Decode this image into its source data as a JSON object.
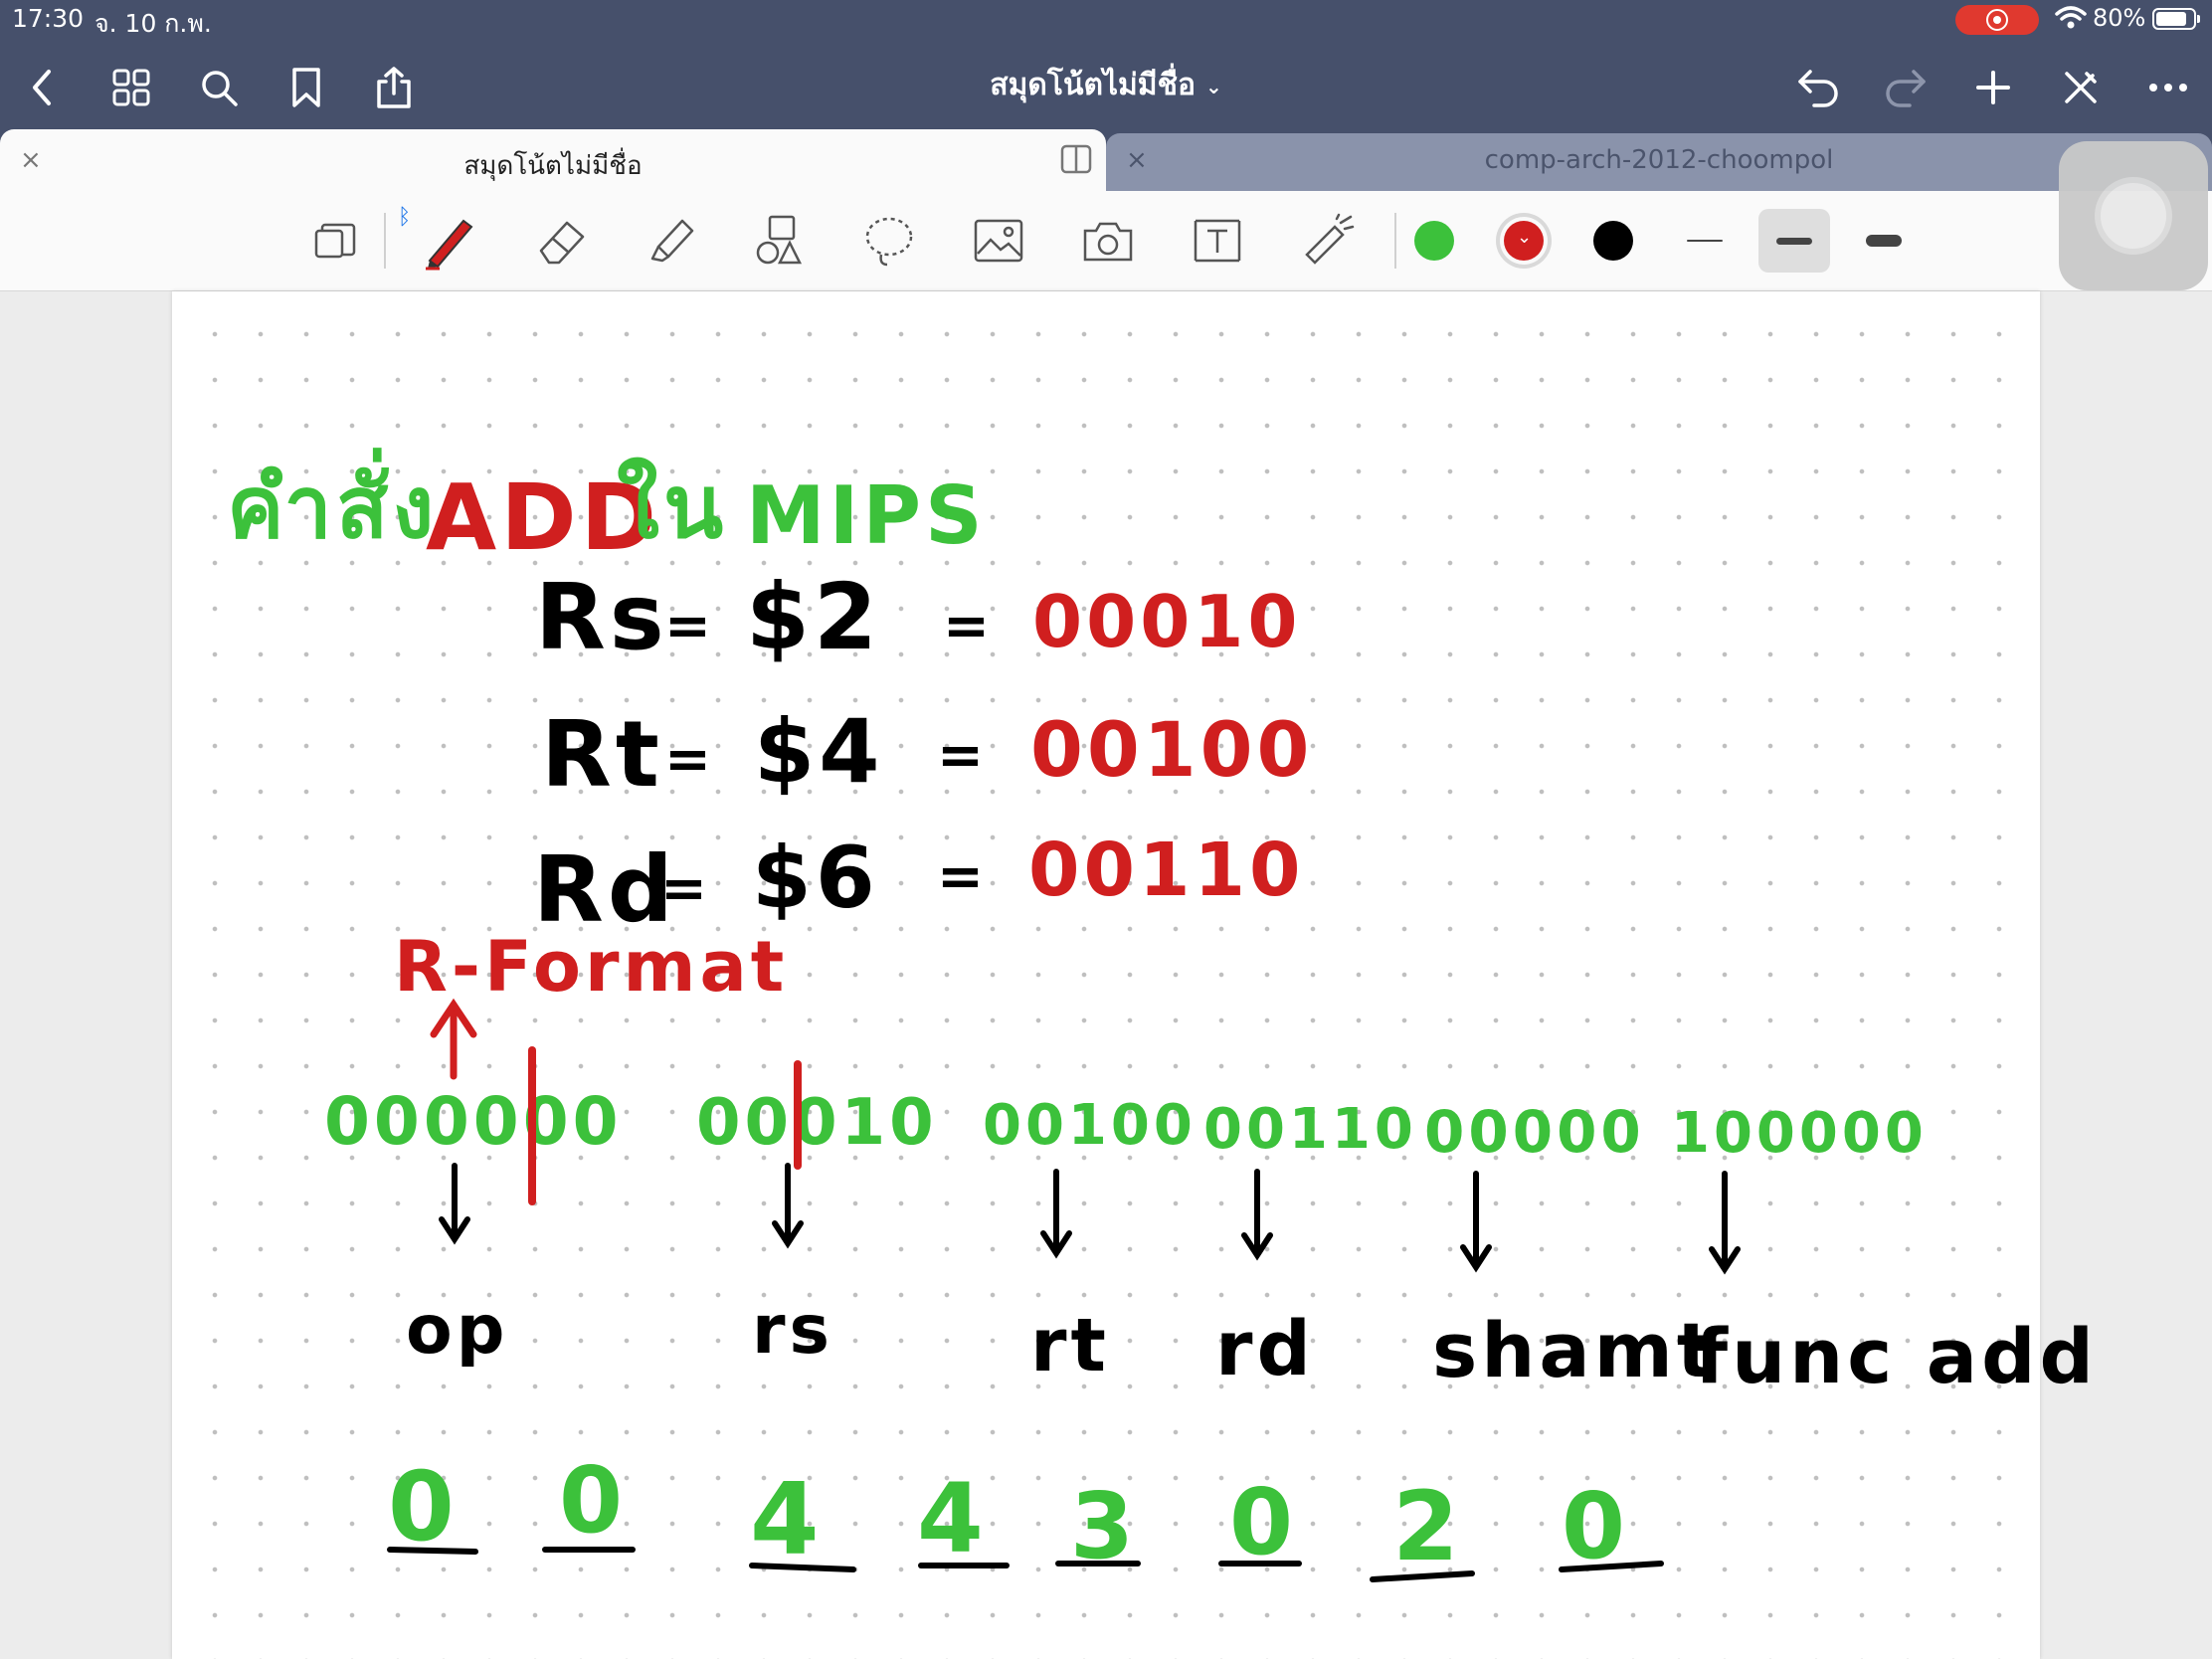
{
  "status": {
    "time": "17:30",
    "date": "จ. 10 ก.พ.",
    "battery": "80%"
  },
  "nav": {
    "title": "สมุดโน้ตไม่มีชื่อ"
  },
  "tabs": [
    {
      "label": "สมุดโน้ตไม่มีชื่อ",
      "active": true
    },
    {
      "label": "comp-arch-2012-choompol",
      "active": false
    }
  ],
  "tools": [
    "page-layout-icon",
    "pen-icon",
    "eraser-icon",
    "highlighter-icon",
    "shapes-icon",
    "lasso-icon",
    "image-icon",
    "camera-icon",
    "text-box-icon",
    "laser-pointer-icon"
  ],
  "colors": {
    "green": "#3cc13b",
    "red": "#d01f1f",
    "black": "#000000",
    "selected": "red"
  },
  "strokes": {
    "selected": "medium"
  },
  "note": {
    "heading_thai_1": "คำสั่ง",
    "heading_add": "ADD",
    "heading_thai_2": "ใน",
    "heading_mips": "MIPS",
    "registers": [
      {
        "name": "Rs",
        "eq": "=",
        "reg": "$2",
        "eq2": "=",
        "bin": "00010"
      },
      {
        "name": "Rt",
        "eq": "=",
        "reg": "$4",
        "eq2": "=",
        "bin": "00100"
      },
      {
        "name": "Rd",
        "eq": "=",
        "reg": "$6",
        "eq2": "=",
        "bin": "00110"
      }
    ],
    "format_label": "R-Format",
    "fields": [
      {
        "bits": "000000",
        "name": "op"
      },
      {
        "bits": "00010",
        "name": "rs"
      },
      {
        "bits": "00100",
        "name": "rt"
      },
      {
        "bits": "00110",
        "name": "rd"
      },
      {
        "bits": "00000",
        "name": "shamt"
      },
      {
        "bits": "100000",
        "name": "func add"
      }
    ],
    "hex_digits": [
      "0",
      "0",
      "4",
      "4",
      "3",
      "0",
      "2",
      "0"
    ]
  }
}
